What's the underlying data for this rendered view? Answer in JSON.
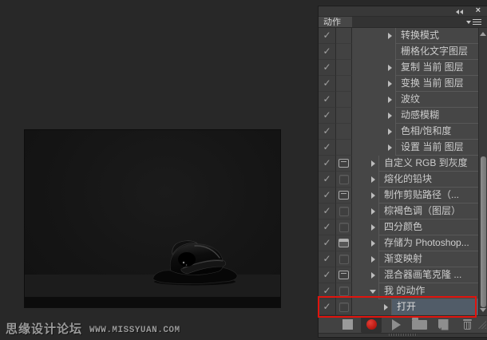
{
  "app": {
    "background": "#282828"
  },
  "document_canvas": {
    "subject": "glossy melted black object on dark backdrop",
    "watermark_cn": "思缘设计论坛",
    "watermark_en": "WWW.MISSYUAN.COM"
  },
  "panel": {
    "tab_label": "动作",
    "icons": {
      "check": "✓",
      "close": "×"
    },
    "rows": [
      {
        "label": "转换模式",
        "level": "command",
        "expander": "collapsed",
        "toggle": "none",
        "checked": true,
        "selected": false
      },
      {
        "label": "栅格化文字图层",
        "level": "command",
        "expander": "none",
        "toggle": "none",
        "checked": true,
        "selected": false
      },
      {
        "label": "复制 当前 图层",
        "level": "command",
        "expander": "collapsed",
        "toggle": "none",
        "checked": true,
        "selected": false
      },
      {
        "label": "变换 当前 图层",
        "level": "command",
        "expander": "collapsed",
        "toggle": "none",
        "checked": true,
        "selected": false
      },
      {
        "label": "波纹",
        "level": "command",
        "expander": "collapsed",
        "toggle": "none",
        "checked": true,
        "selected": false
      },
      {
        "label": "动感模糊",
        "level": "command",
        "expander": "collapsed",
        "toggle": "none",
        "checked": true,
        "selected": false
      },
      {
        "label": "色相/饱和度",
        "level": "command",
        "expander": "collapsed",
        "toggle": "none",
        "checked": true,
        "selected": false
      },
      {
        "label": "设置 当前 图层",
        "level": "command",
        "expander": "collapsed",
        "toggle": "none",
        "checked": true,
        "selected": false
      },
      {
        "label": "自定义 RGB 到灰度",
        "level": "action",
        "expander": "collapsed",
        "toggle": "dialog",
        "checked": true,
        "selected": false
      },
      {
        "label": "熔化的铅块",
        "level": "action",
        "expander": "collapsed",
        "toggle": "none",
        "checked": true,
        "selected": false
      },
      {
        "label": "制作剪贴路径（...",
        "level": "action",
        "expander": "collapsed",
        "toggle": "dialog",
        "checked": true,
        "selected": false
      },
      {
        "label": "棕褐色调（图层）",
        "level": "action",
        "expander": "collapsed",
        "toggle": "none",
        "checked": true,
        "selected": false
      },
      {
        "label": "四分颜色",
        "level": "action",
        "expander": "collapsed",
        "toggle": "none",
        "checked": true,
        "selected": false
      },
      {
        "label": "存储为 Photoshop...",
        "level": "action",
        "expander": "collapsed",
        "toggle": "dialog-filled",
        "checked": true,
        "selected": false
      },
      {
        "label": "渐变映射",
        "level": "action",
        "expander": "collapsed",
        "toggle": "none",
        "checked": true,
        "selected": false
      },
      {
        "label": "混合器画笔克隆 ...",
        "level": "action",
        "expander": "collapsed",
        "toggle": "dialog",
        "checked": true,
        "selected": false
      },
      {
        "label": "我 的动作",
        "level": "action",
        "expander": "expanded",
        "toggle": "none",
        "checked": true,
        "selected": false
      },
      {
        "label": "打开",
        "level": "command",
        "expander": "collapsed",
        "toggle": "none",
        "checked": true,
        "selected": true
      }
    ],
    "toolbar": {
      "buttons": [
        "stop-button",
        "record-button",
        "play-button",
        "new-set-button",
        "new-action-button",
        "delete-button"
      ],
      "record_active": true
    },
    "scrollbar": {
      "thumb_visible": true
    },
    "annotation": {
      "shape": "red-rectangle",
      "color": "#e0140e",
      "highlights": "打开"
    }
  },
  "colors": {
    "selection": "#515c68",
    "annotation_red": "#e0140e",
    "record_red": "#c01e16",
    "panel_bg": "#464646",
    "app_bg": "#282828"
  }
}
